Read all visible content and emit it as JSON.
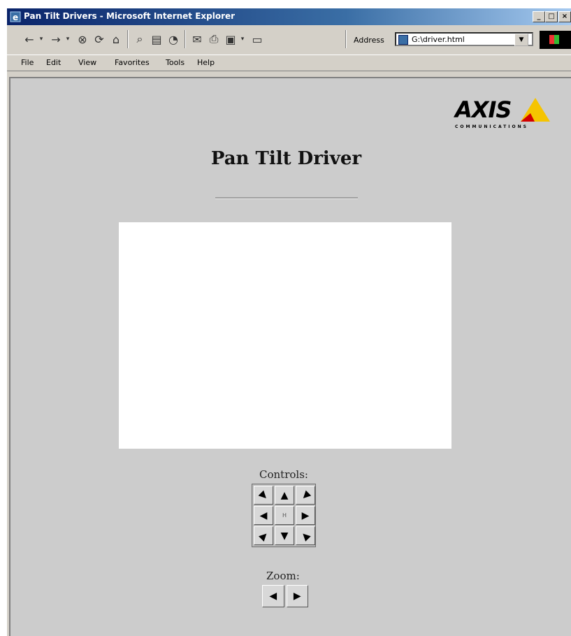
{
  "window": {
    "title": "Pan Tilt Drivers - Microsoft Internet Explorer",
    "buttons": [
      "_",
      "□",
      "×"
    ]
  },
  "toolbar": {
    "address_label": "Address",
    "address_value": "G:\\driver.html",
    "icons": [
      "back-icon",
      "forward-icon",
      "stop-icon",
      "refresh-icon",
      "home-icon",
      "search-icon",
      "favorites-icon",
      "history-icon",
      "mail-icon",
      "print-icon",
      "edit-icon",
      "discuss-icon"
    ]
  },
  "menu": {
    "items": [
      "File",
      "Edit",
      "View",
      "Favorites",
      "Tools",
      "Help"
    ]
  },
  "logo": {
    "word": "AXIS",
    "sub": "COMMUNICATIONS",
    "colors": {
      "triangle_yellow": "#f5c400",
      "triangle_red": "#d10000"
    }
  },
  "page": {
    "title": "Pan Tilt Driver",
    "controls_label": "Controls:",
    "zoom_label": "Zoom:"
  },
  "controls": {
    "pad": [
      {
        "name": "up-left-button",
        "glyph": "▶",
        "rot": "45deg"
      },
      {
        "name": "up-button",
        "glyph": "▲",
        "rot": "0deg"
      },
      {
        "name": "up-right-button",
        "glyph": "◀",
        "rot": "-45deg"
      },
      {
        "name": "left-button",
        "glyph": "◀",
        "rot": "0deg"
      },
      {
        "name": "home-button",
        "glyph": "H",
        "rot": "0deg"
      },
      {
        "name": "right-button",
        "glyph": "▶",
        "rot": "0deg"
      },
      {
        "name": "down-left-button",
        "glyph": "▶",
        "rot": "-45deg"
      },
      {
        "name": "down-button",
        "glyph": "▼",
        "rot": "0deg"
      },
      {
        "name": "down-right-button",
        "glyph": "◀",
        "rot": "45deg"
      }
    ],
    "zoom": [
      {
        "name": "zoom-out-button",
        "glyph": "◀"
      },
      {
        "name": "zoom-in-button",
        "glyph": "▶"
      }
    ]
  }
}
